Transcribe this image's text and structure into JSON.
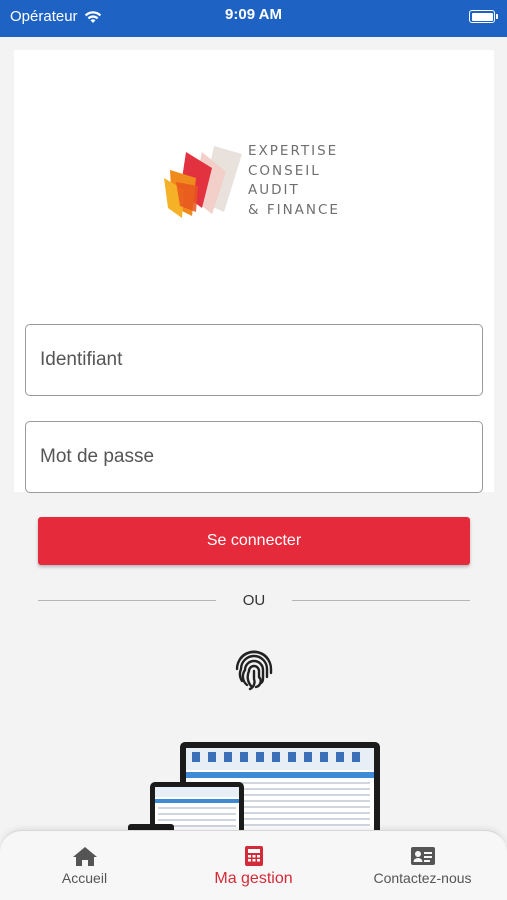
{
  "status_bar": {
    "carrier": "Opérateur",
    "time": "9:09 AM"
  },
  "logo": {
    "lines": [
      "EXPERTISE",
      "CONSEIL",
      "AUDIT",
      "& FINANCE"
    ]
  },
  "form": {
    "username_placeholder": "Identifiant",
    "password_placeholder": "Mot de passe",
    "login_label": "Se connecter",
    "separator_label": "OU"
  },
  "tab_bar": {
    "items": [
      {
        "label": "Accueil",
        "icon": "home-icon",
        "active": false
      },
      {
        "label": "Ma gestion",
        "icon": "calculator-icon",
        "active": true
      },
      {
        "label": "Contactez-nous",
        "icon": "contact-card-icon",
        "active": false
      }
    ]
  },
  "colors": {
    "status_bar": "#1e63c4",
    "accent": "#e52b3b",
    "active_tab": "#d42b38"
  }
}
